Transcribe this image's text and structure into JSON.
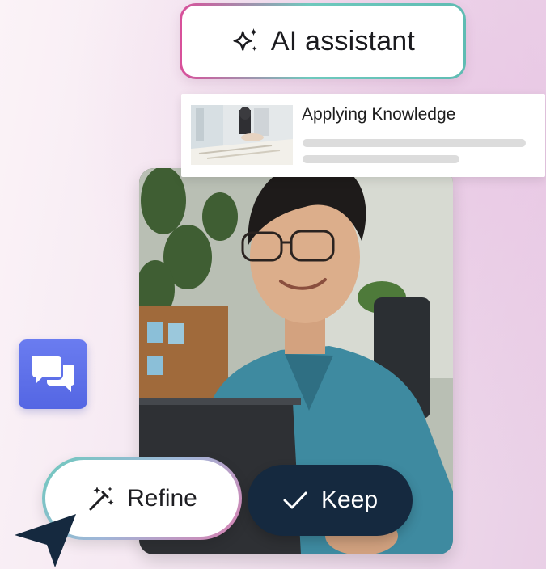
{
  "ai_assistant": {
    "label": "AI assistant",
    "icon": "sparkles-icon"
  },
  "knowledge_card": {
    "title": "Applying Knowledge",
    "thumbnail": "meeting-thumbnail-image"
  },
  "photo": {
    "subject": "person-at-laptop-photo"
  },
  "chat": {
    "icon": "chat-bubbles-icon"
  },
  "refine": {
    "label": "Refine",
    "icon": "magic-wand-icon"
  },
  "keep": {
    "label": "Keep",
    "icon": "checkmark-icon"
  },
  "colors": {
    "keep_bg": "#15293f",
    "chat_bg": "#5a6be6",
    "accent_pink": "#d94f9a",
    "accent_teal": "#6fc9bd"
  }
}
